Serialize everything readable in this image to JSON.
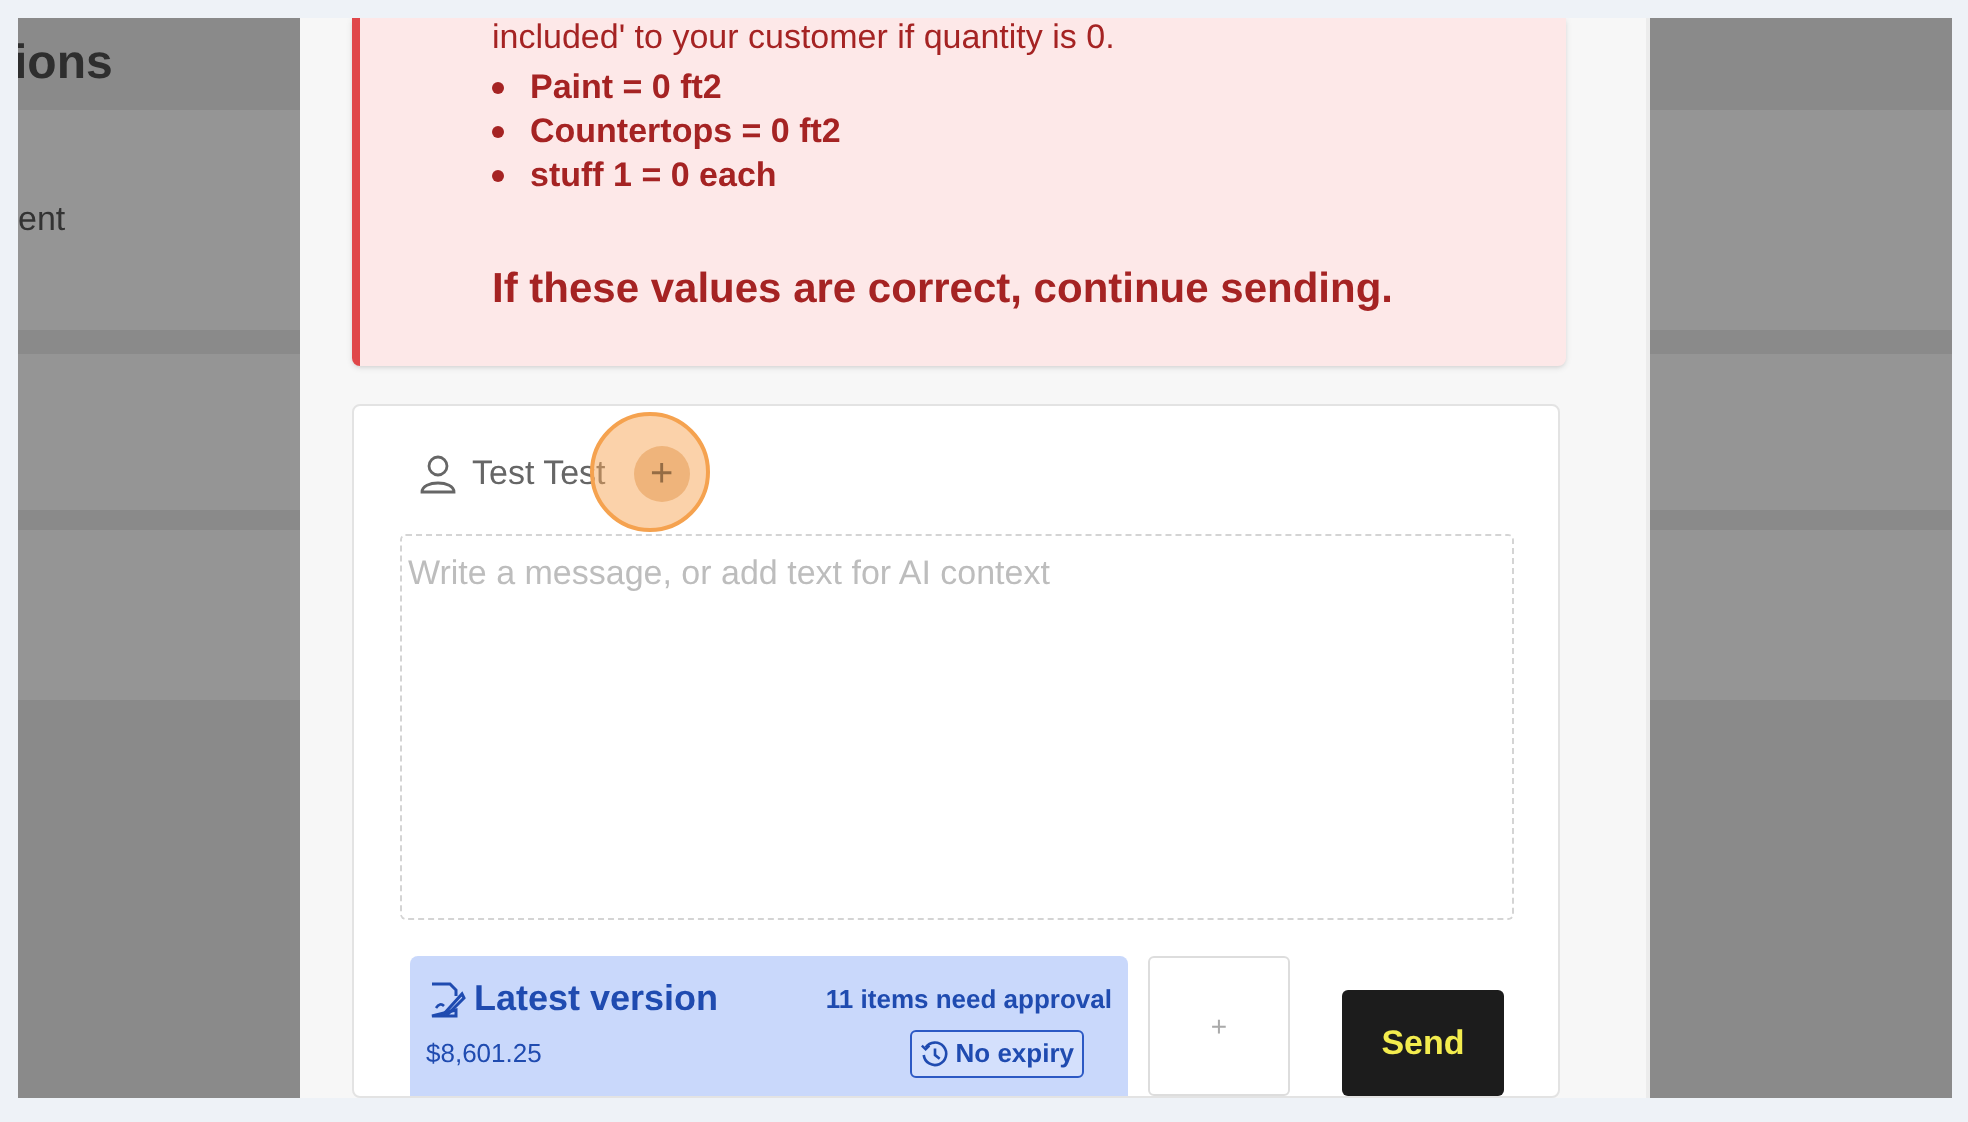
{
  "backdrop": {
    "heading": "ions",
    "row_label": "ent"
  },
  "alert": {
    "intro": "included' to your customer if quantity is 0.",
    "items": [
      "Paint = 0 ft2",
      "Countertops = 0 ft2",
      "stuff 1 = 0 each"
    ],
    "footer": "If these values are correct, continue sending."
  },
  "composer": {
    "recipient": "Test Test",
    "add_label": "+",
    "message": {
      "placeholder": "Write a message, or add text for AI context"
    },
    "version": {
      "title": "Latest version",
      "approval": "11 items need approval",
      "price": "$8,601.25",
      "expiry": "No expiry"
    },
    "attach_label": "+",
    "send_label": "Send"
  }
}
